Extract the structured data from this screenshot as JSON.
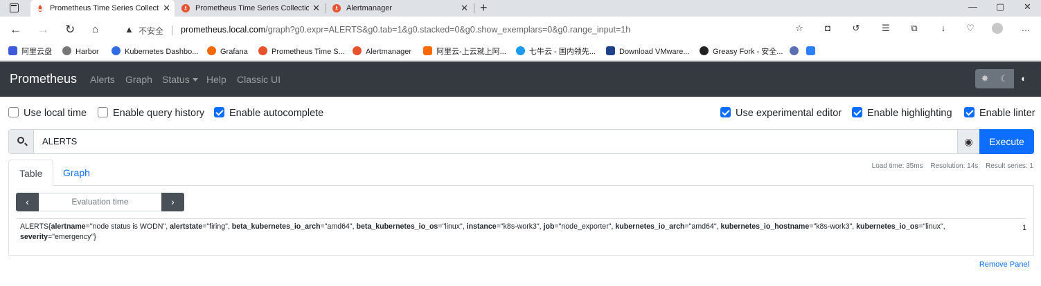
{
  "browser": {
    "tabs": [
      {
        "title": "Prometheus Time Series Collectio",
        "active": true
      },
      {
        "title": "Prometheus Time Series Collectio",
        "active": false
      },
      {
        "title": "Alertmanager",
        "active": false
      }
    ],
    "tab_close": "✕",
    "new_tab": "+",
    "window_controls": [
      "—",
      "▢",
      "✕"
    ],
    "insecure_label": "不安全",
    "url_host": "prometheus.local.com",
    "url_rest": "/graph?g0.expr=ALERTS&g0.tab=1&g0.stacked=0&g0.show_exemplars=0&g0.range_input=1h",
    "bookmarks": [
      {
        "label": "阿里云盘",
        "color": "#3b5bdb"
      },
      {
        "label": "Harbor",
        "color": "#555"
      },
      {
        "label": "Kubernetes Dashbo...",
        "color": "#326ce5"
      },
      {
        "label": "Grafana",
        "color": "#f46800"
      },
      {
        "label": "Prometheus Time S...",
        "color": "#e6522c"
      },
      {
        "label": "Alertmanager",
        "color": "#e6522c"
      },
      {
        "label": "阿里云-上云就上阿...",
        "color": "#ff6a00"
      },
      {
        "label": "七牛云 - 国内领先...",
        "color": "#1a9bf0"
      },
      {
        "label": "Download VMware...",
        "color": "#1d428a"
      },
      {
        "label": "Greasy Fork - 安全...",
        "color": "#222"
      },
      {
        "label": "",
        "color": "#5b6fb3"
      },
      {
        "label": "",
        "color": "#2d7ff9"
      }
    ]
  },
  "navbar": {
    "brand": "Prometheus",
    "links": [
      "Alerts",
      "Graph",
      "Status",
      "Help",
      "Classic UI"
    ]
  },
  "options": {
    "left": [
      {
        "label": "Use local time",
        "checked": false
      },
      {
        "label": "Enable query history",
        "checked": false
      },
      {
        "label": "Enable autocomplete",
        "checked": true
      }
    ],
    "right": [
      {
        "label": "Use experimental editor",
        "checked": true
      },
      {
        "label": "Enable highlighting",
        "checked": true
      },
      {
        "label": "Enable linter",
        "checked": true
      }
    ]
  },
  "query": {
    "expression": "ALERTS",
    "execute_label": "Execute"
  },
  "panel": {
    "tabs": [
      "Table",
      "Graph"
    ],
    "stats": {
      "load_time": "Load time: 35ms",
      "resolution": "Resolution: 14s",
      "result_series": "Result series: 1"
    },
    "evaluation_placeholder": "Evaluation time",
    "prev": "‹",
    "next": "›",
    "result": {
      "metric": "ALERTS",
      "labels": [
        {
          "k": "alertname",
          "v": "\"node status is WODN\""
        },
        {
          "k": "alertstate",
          "v": "\"firing\""
        },
        {
          "k": "beta_kubernetes_io_arch",
          "v": "\"amd64\""
        },
        {
          "k": "beta_kubernetes_io_os",
          "v": "\"linux\""
        },
        {
          "k": "instance",
          "v": "\"k8s-work3\""
        },
        {
          "k": "job",
          "v": "\"node_exporter\""
        },
        {
          "k": "kubernetes_io_arch",
          "v": "\"amd64\""
        },
        {
          "k": "kubernetes_io_hostname",
          "v": "\"k8s-work3\""
        },
        {
          "k": "kubernetes_io_os",
          "v": "\"linux\""
        },
        {
          "k": "severity",
          "v": "\"emergency\""
        }
      ],
      "value": "1"
    },
    "remove_label": "Remove Panel"
  }
}
